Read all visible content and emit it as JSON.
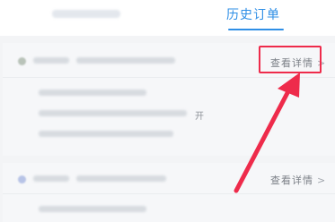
{
  "tabs": {
    "history_label": "历史订单"
  },
  "orders": [
    {
      "detail_label": "查看详情",
      "tail_text": "开"
    },
    {
      "detail_label": "查看详情"
    }
  ],
  "colors": {
    "accent": "#2f8fe6",
    "highlight": "#ee2b4b"
  },
  "icons": {
    "chevron": "chevron-right-icon",
    "arrow": "pointer-arrow-icon"
  }
}
